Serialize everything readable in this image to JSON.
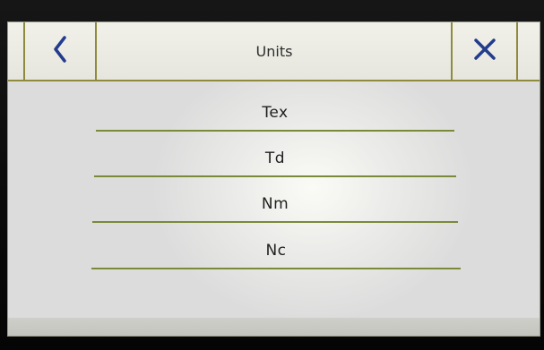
{
  "header": {
    "back_icon": "chevron-left-icon",
    "title": "Units",
    "close_icon": "close-icon"
  },
  "units": [
    {
      "label": "Tex"
    },
    {
      "label": "Td"
    },
    {
      "label": "Nm"
    },
    {
      "label": "Nc"
    }
  ],
  "colors": {
    "accent_blue": "#233c8c",
    "divider_olive": "#8e8a3e"
  }
}
